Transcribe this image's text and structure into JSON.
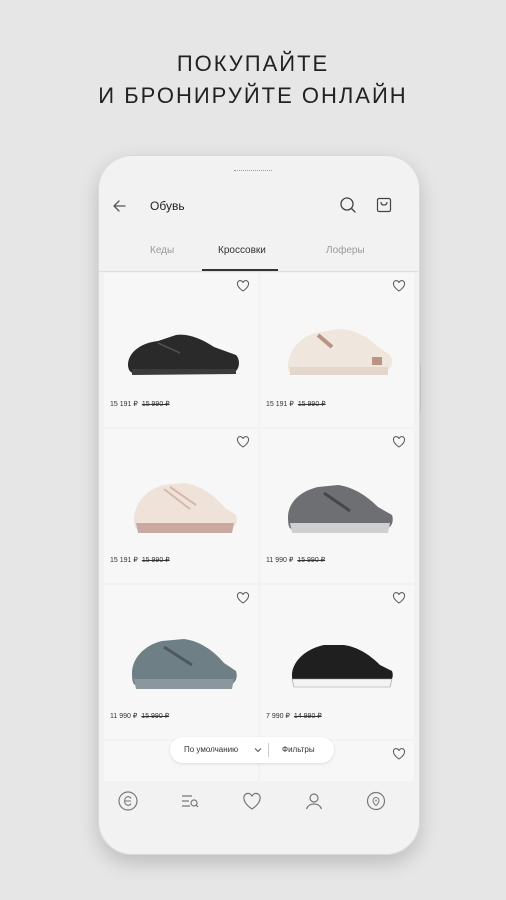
{
  "headline": {
    "line1": "ПОКУПАЙТЕ",
    "line2": "И БРОНИРУЙТЕ ОНЛАЙН"
  },
  "appbar": {
    "title": "Обувь",
    "icons": [
      "back-arrow-icon",
      "search-icon",
      "shopping-bag-icon"
    ]
  },
  "tabs": [
    {
      "label": "Кеды",
      "active": false
    },
    {
      "label": "Кроссовки",
      "active": true
    },
    {
      "label": "Лоферы",
      "active": false
    }
  ],
  "products": [
    {
      "price": "15 191 ₽",
      "old_price": "15 990 ₽",
      "shoe_color": "#2a2a2a"
    },
    {
      "price": "15 191 ₽",
      "old_price": "15 990 ₽",
      "shoe_color": "#efe6dd"
    },
    {
      "price": "15 191 ₽",
      "old_price": "15 990 ₽",
      "shoe_color": "#efe2d8"
    },
    {
      "price": "11 990 ₽",
      "old_price": "15 990 ₽",
      "shoe_color": "#6d6f73"
    },
    {
      "price": "11 990 ₽",
      "old_price": "15 990 ₽",
      "shoe_color": "#6f7f86"
    },
    {
      "price": "7 990 ₽",
      "old_price": "14 990 ₽",
      "shoe_color": "#1f1f1f"
    }
  ],
  "sortbar": {
    "sort_label": "По умолчанию",
    "filters_label": "Фильтры"
  },
  "bottom_nav": [
    "logo-e-icon",
    "catalog-search-icon",
    "favorites-heart-icon",
    "profile-icon",
    "store-location-icon"
  ],
  "colors": {
    "background": "#e6e6e6",
    "phone": "#f2f2f2",
    "card": "#f7f7f7",
    "accent": "#333333"
  }
}
